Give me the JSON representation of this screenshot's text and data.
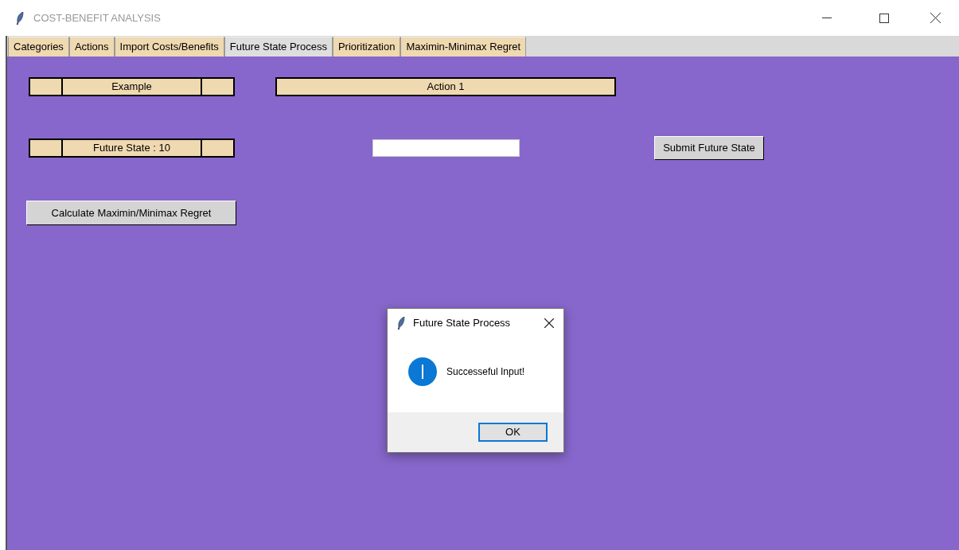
{
  "window": {
    "title": "COST-BENEFIT ANALYSIS"
  },
  "tabs": [
    {
      "label": "Categories",
      "selected": false
    },
    {
      "label": "Actions",
      "selected": false
    },
    {
      "label": "Import Costs/Benefits",
      "selected": false
    },
    {
      "label": "Future State Process",
      "selected": true
    },
    {
      "label": "Prioritization",
      "selected": false
    },
    {
      "label": "Maximin-Minimax Regret",
      "selected": false
    }
  ],
  "example_label": "Example",
  "action_label": "Action 1",
  "future_state_label": "Future State : 10",
  "submit_button": "Submit Future State",
  "calculate_button": "Calculate Maximin/Minimax Regret",
  "dialog": {
    "title": "Future State Process",
    "message": "Successeful Input!",
    "ok_button": "OK"
  }
}
